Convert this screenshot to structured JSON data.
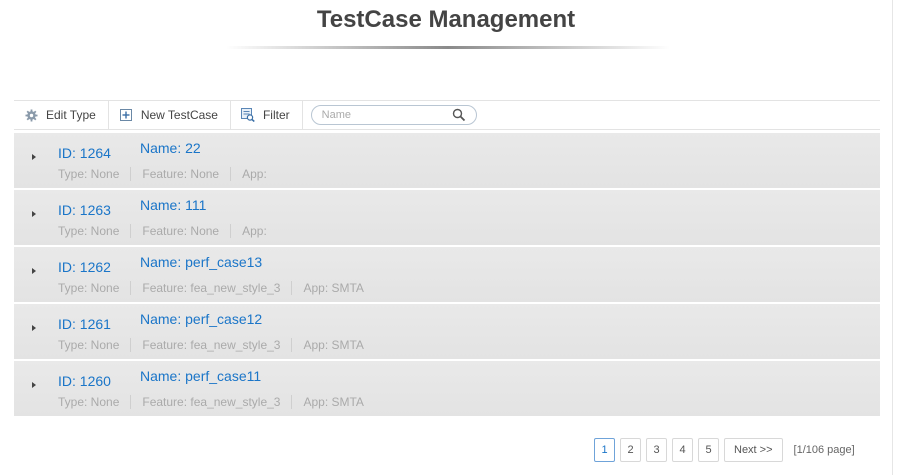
{
  "page": {
    "title": "TestCase Management"
  },
  "toolbar": {
    "edit_type": {
      "label": "Edit Type",
      "icon": "gear-icon"
    },
    "new_testcase": {
      "label": "New TestCase",
      "icon": "plus-box-icon"
    },
    "filter": {
      "label": "Filter",
      "icon": "filter-icon"
    },
    "search": {
      "placeholder": "Name",
      "value": ""
    }
  },
  "testcases": [
    {
      "id": "ID: 1264",
      "name": "Name: 22",
      "type": "Type: None",
      "feature": "Feature: None",
      "app": "App:"
    },
    {
      "id": "ID: 1263",
      "name": "Name: 111",
      "type": "Type: None",
      "feature": "Feature: None",
      "app": "App:"
    },
    {
      "id": "ID: 1262",
      "name": "Name: perf_case13",
      "type": "Type: None",
      "feature": "Feature: fea_new_style_3",
      "app": "App: SMTA"
    },
    {
      "id": "ID: 1261",
      "name": "Name: perf_case12",
      "type": "Type: None",
      "feature": "Feature: fea_new_style_3",
      "app": "App: SMTA"
    },
    {
      "id": "ID: 1260",
      "name": "Name: perf_case11",
      "type": "Type: None",
      "feature": "Feature: fea_new_style_3",
      "app": "App: SMTA"
    }
  ],
  "pagination": {
    "pages": [
      "1",
      "2",
      "3",
      "4",
      "5"
    ],
    "current": "1",
    "next_label": "Next >>",
    "info": "[1/106 page]"
  },
  "colors": {
    "link": "#1a75c8",
    "row_bg": "#e6e6e6",
    "meta_text": "#aaaaaa"
  }
}
